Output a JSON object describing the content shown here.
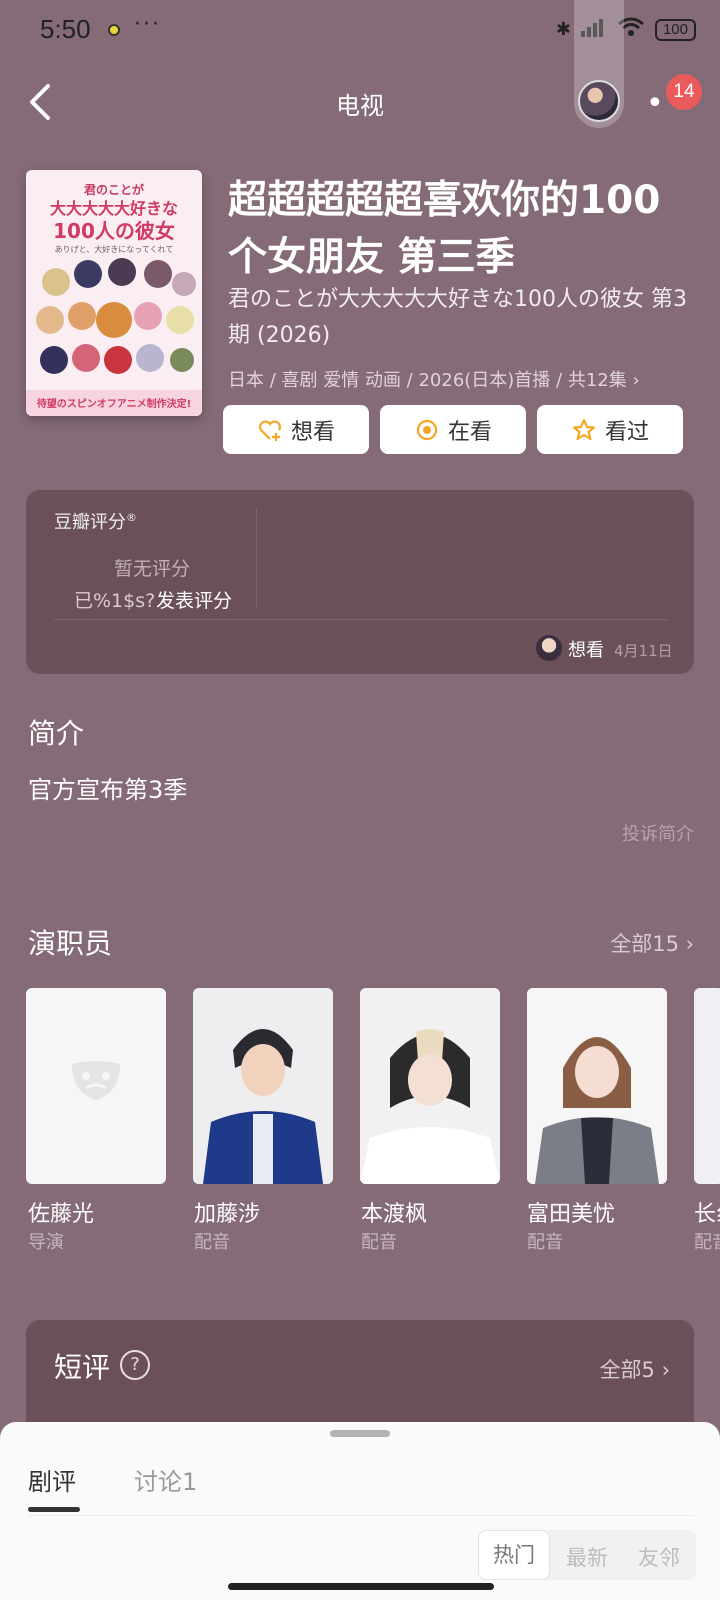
{
  "status_bar": {
    "time": "5:50",
    "more": "···",
    "battery": "100"
  },
  "header": {
    "title": "电视",
    "notification_count": "14"
  },
  "poster": {
    "top_text": "君のことが大大大大大好きな100人の彼女",
    "sub_text": "ありげと、大好きになってくれて",
    "banner_text": "待望のスピンオフアニメ制作決定!"
  },
  "show": {
    "title": "超超超超超喜欢你的100个女朋友 第三季",
    "original_title": "君のことが大大大大大好きな100人の彼女 第3期 (2026)",
    "meta": "日本 / 喜剧 爱情 动画 / 2026(日本)首播 / 共12集 ›"
  },
  "actions": [
    {
      "label": "想看",
      "icon": "heart-plus-icon",
      "color": "#f5a623"
    },
    {
      "label": "在看",
      "icon": "target-icon",
      "color": "#f5a623"
    },
    {
      "label": "看过",
      "icon": "star-icon",
      "color": "#f5a623"
    }
  ],
  "rating": {
    "label": "豆瓣评分",
    "reg": "®",
    "no_rating": "暂无评分",
    "prompt": "已%1$s?",
    "write": "发表评分",
    "mark_status": "想看",
    "mark_date": "4月11日"
  },
  "intro": {
    "heading": "简介",
    "text": "官方宣布第3季",
    "report": "投诉简介"
  },
  "cast": {
    "heading": "演职员",
    "all": "全部15 ›",
    "members": [
      {
        "name": "佐藤光",
        "role": "导演"
      },
      {
        "name": "加藤涉",
        "role": "配音"
      },
      {
        "name": "本渡枫",
        "role": "配音"
      },
      {
        "name": "富田美忧",
        "role": "配音"
      },
      {
        "name": "长纟",
        "role": "配音"
      }
    ]
  },
  "short_review": {
    "heading": "短评",
    "help": "?",
    "all": "全部5 ›"
  },
  "sheet": {
    "tabs": [
      {
        "label": "剧评"
      },
      {
        "label": "讨论1"
      }
    ],
    "sort": [
      "热门",
      "最新",
      "友邻"
    ]
  },
  "colors": {
    "background": "#856a78",
    "card": "#6b5059",
    "accent": "#f5a623",
    "badge": "#ec5b5b"
  }
}
